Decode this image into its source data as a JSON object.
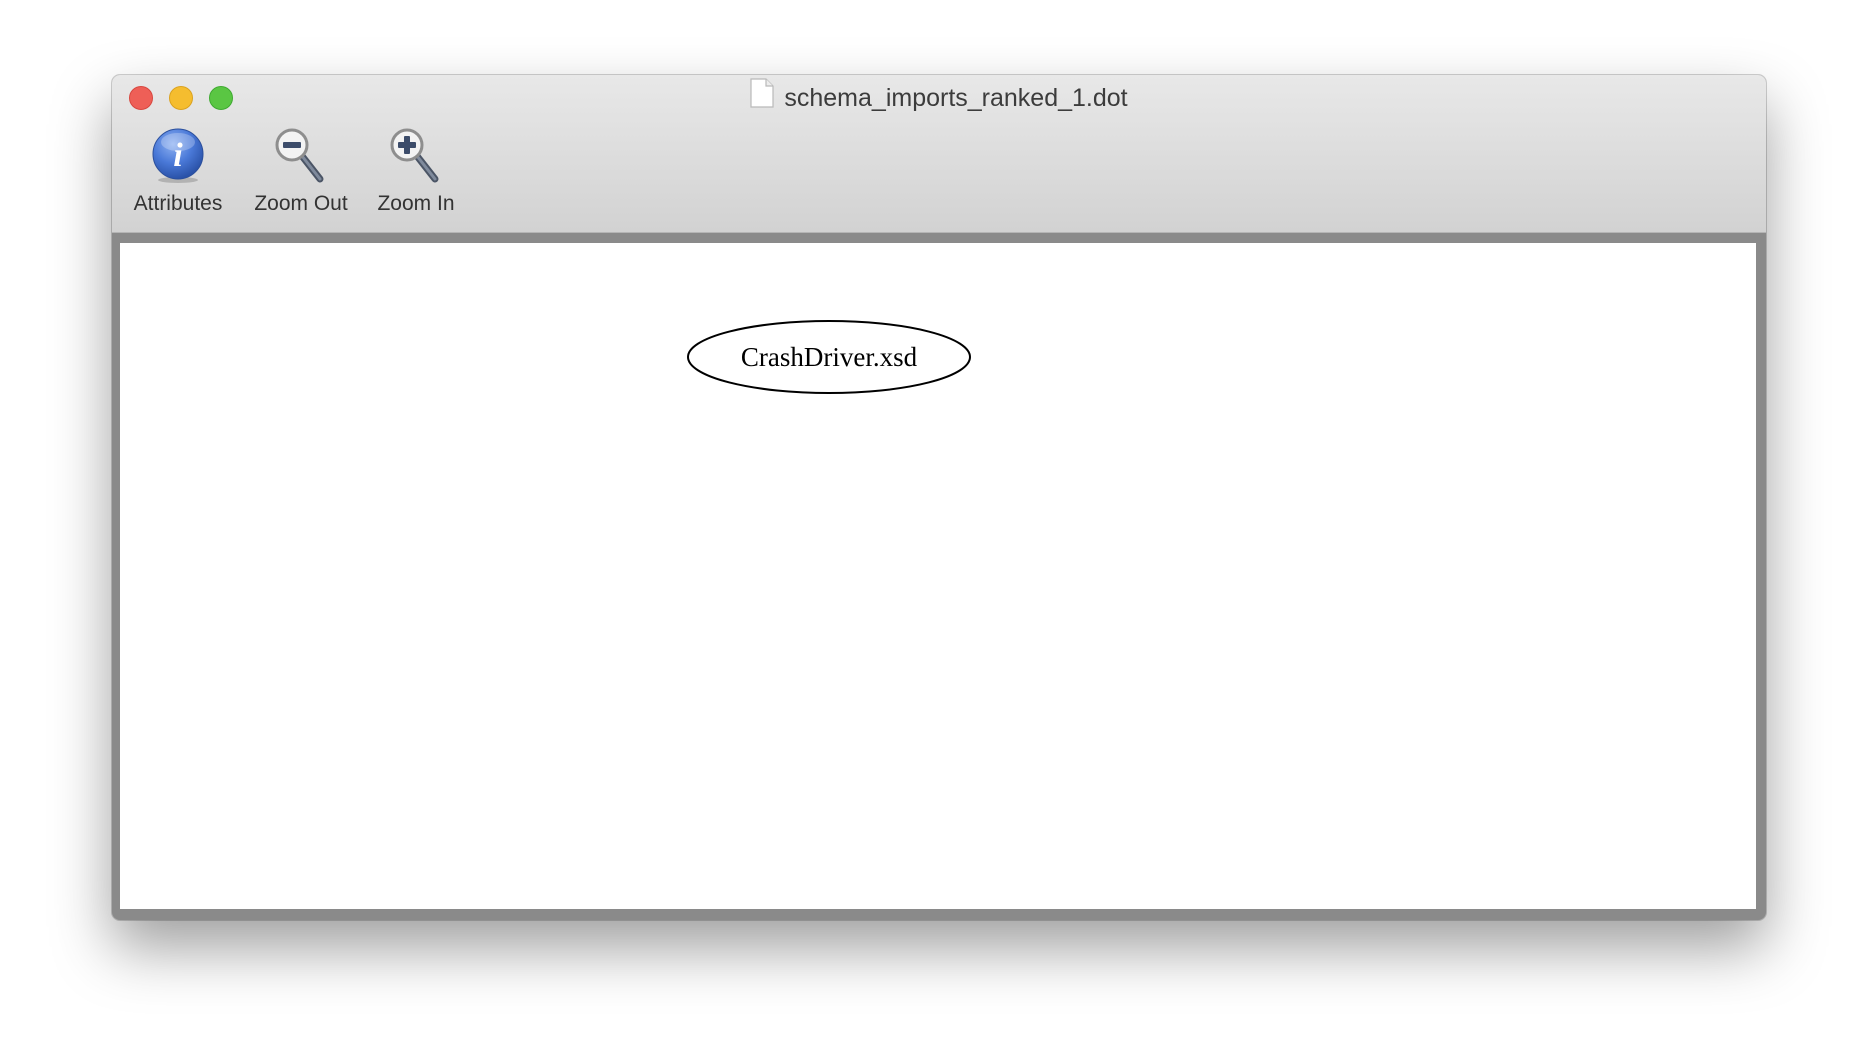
{
  "window": {
    "title": "schema_imports_ranked_1.dot"
  },
  "toolbar": {
    "items": [
      {
        "label": "Attributes",
        "icon": "info-icon"
      },
      {
        "label": "Zoom Out",
        "icon": "zoom-out-icon"
      },
      {
        "label": "Zoom In",
        "icon": "zoom-in-icon"
      }
    ]
  },
  "graph": {
    "nodes": [
      {
        "label": "CrashDriver.xsd",
        "shape": "ellipse"
      }
    ]
  },
  "colors": {
    "close": "#ee5f57",
    "minimize": "#f5bd2f",
    "maximize": "#5ac643",
    "info_blue": "#3f6fd1"
  }
}
